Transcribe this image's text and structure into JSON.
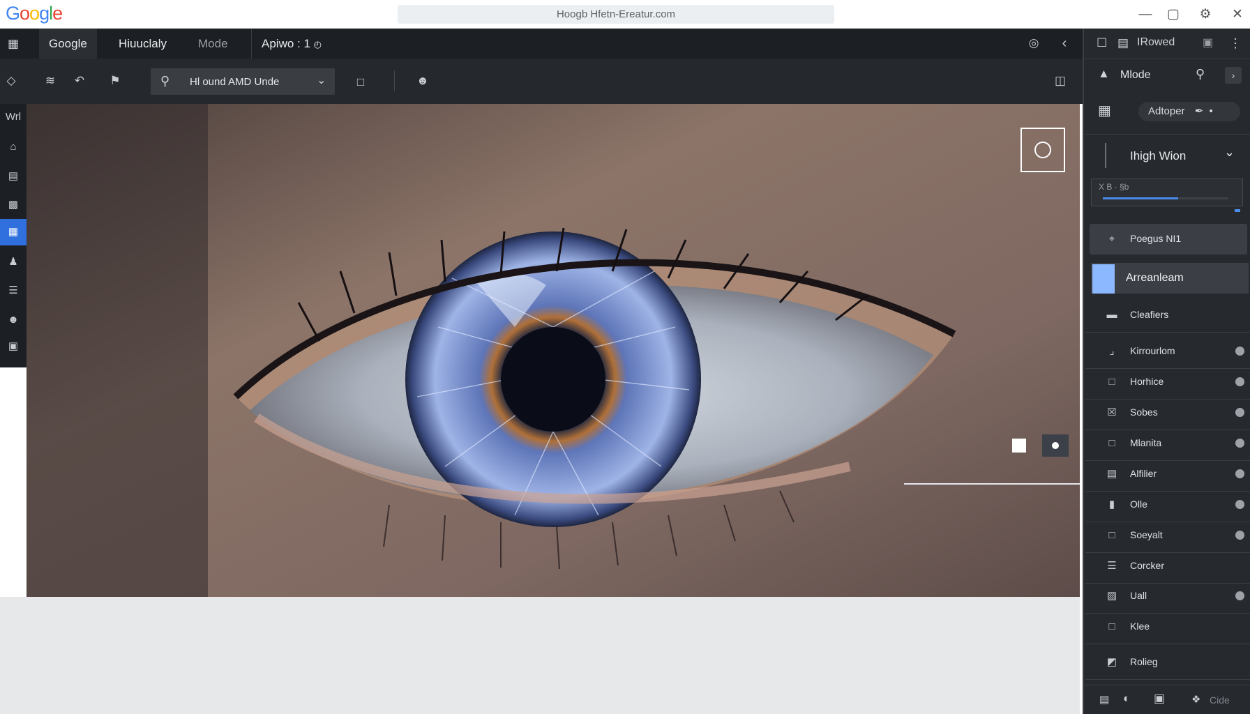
{
  "app": {
    "logo": "Google",
    "url": "Hoogb Hfetn-Ereatur.com"
  },
  "window_controls": [
    "minimize-icon",
    "maximize-icon",
    "settings-icon",
    "close-icon"
  ],
  "menubar": {
    "items": [
      {
        "label": "Google"
      },
      {
        "label": "Hiuuclaly"
      },
      {
        "label": "Mode"
      },
      {
        "label": "Apiwo : 1"
      }
    ]
  },
  "toolbar": {
    "search_text": "Hl ound AMD Unde"
  },
  "left_rail": {
    "label_top": "Wrl"
  },
  "right_panel": {
    "header_title": "IRowed",
    "mode_label": "Mlode",
    "dropdown_label": "Adtoper",
    "section_title": "Ihigh Wion",
    "slider_label": "X B · §b",
    "slider_value": 0.6,
    "items": [
      {
        "label": "Poegus NI1",
        "icon": "focus-icon",
        "state": "hover"
      },
      {
        "label": "Arreanleam",
        "icon": "color-swatch-icon",
        "state": "selected"
      },
      {
        "label": "Cleafiers",
        "icon": "comment-icon"
      },
      {
        "label": "Kirrourlom",
        "icon": "crop-icon",
        "eye": true
      },
      {
        "label": "Horhice",
        "icon": "frame-icon",
        "eye": true
      },
      {
        "label": "Sobes",
        "icon": "x-box-icon",
        "eye": true
      },
      {
        "label": "Mlanita",
        "icon": "frame-icon",
        "eye": true
      },
      {
        "label": "Alfilier",
        "icon": "doc-icon",
        "eye": true
      },
      {
        "label": "Olle",
        "icon": "page-icon",
        "eye": true
      },
      {
        "label": "Soeyalt",
        "icon": "frame-icon",
        "eye": true
      },
      {
        "label": "Corcker",
        "icon": "layers-icon"
      },
      {
        "label": "Uall",
        "icon": "edit-box-icon",
        "eye": true
      },
      {
        "label": "Klee",
        "icon": "square-icon"
      },
      {
        "label": "Rolieg",
        "icon": "gradient-icon"
      }
    ],
    "footer": {
      "right_label": "Cide"
    }
  },
  "colors": {
    "dark_bg": "#1c1f23",
    "panel_bg": "#26292d",
    "selection": "#8bb8ff",
    "slider_fill": "#4a8de8"
  }
}
